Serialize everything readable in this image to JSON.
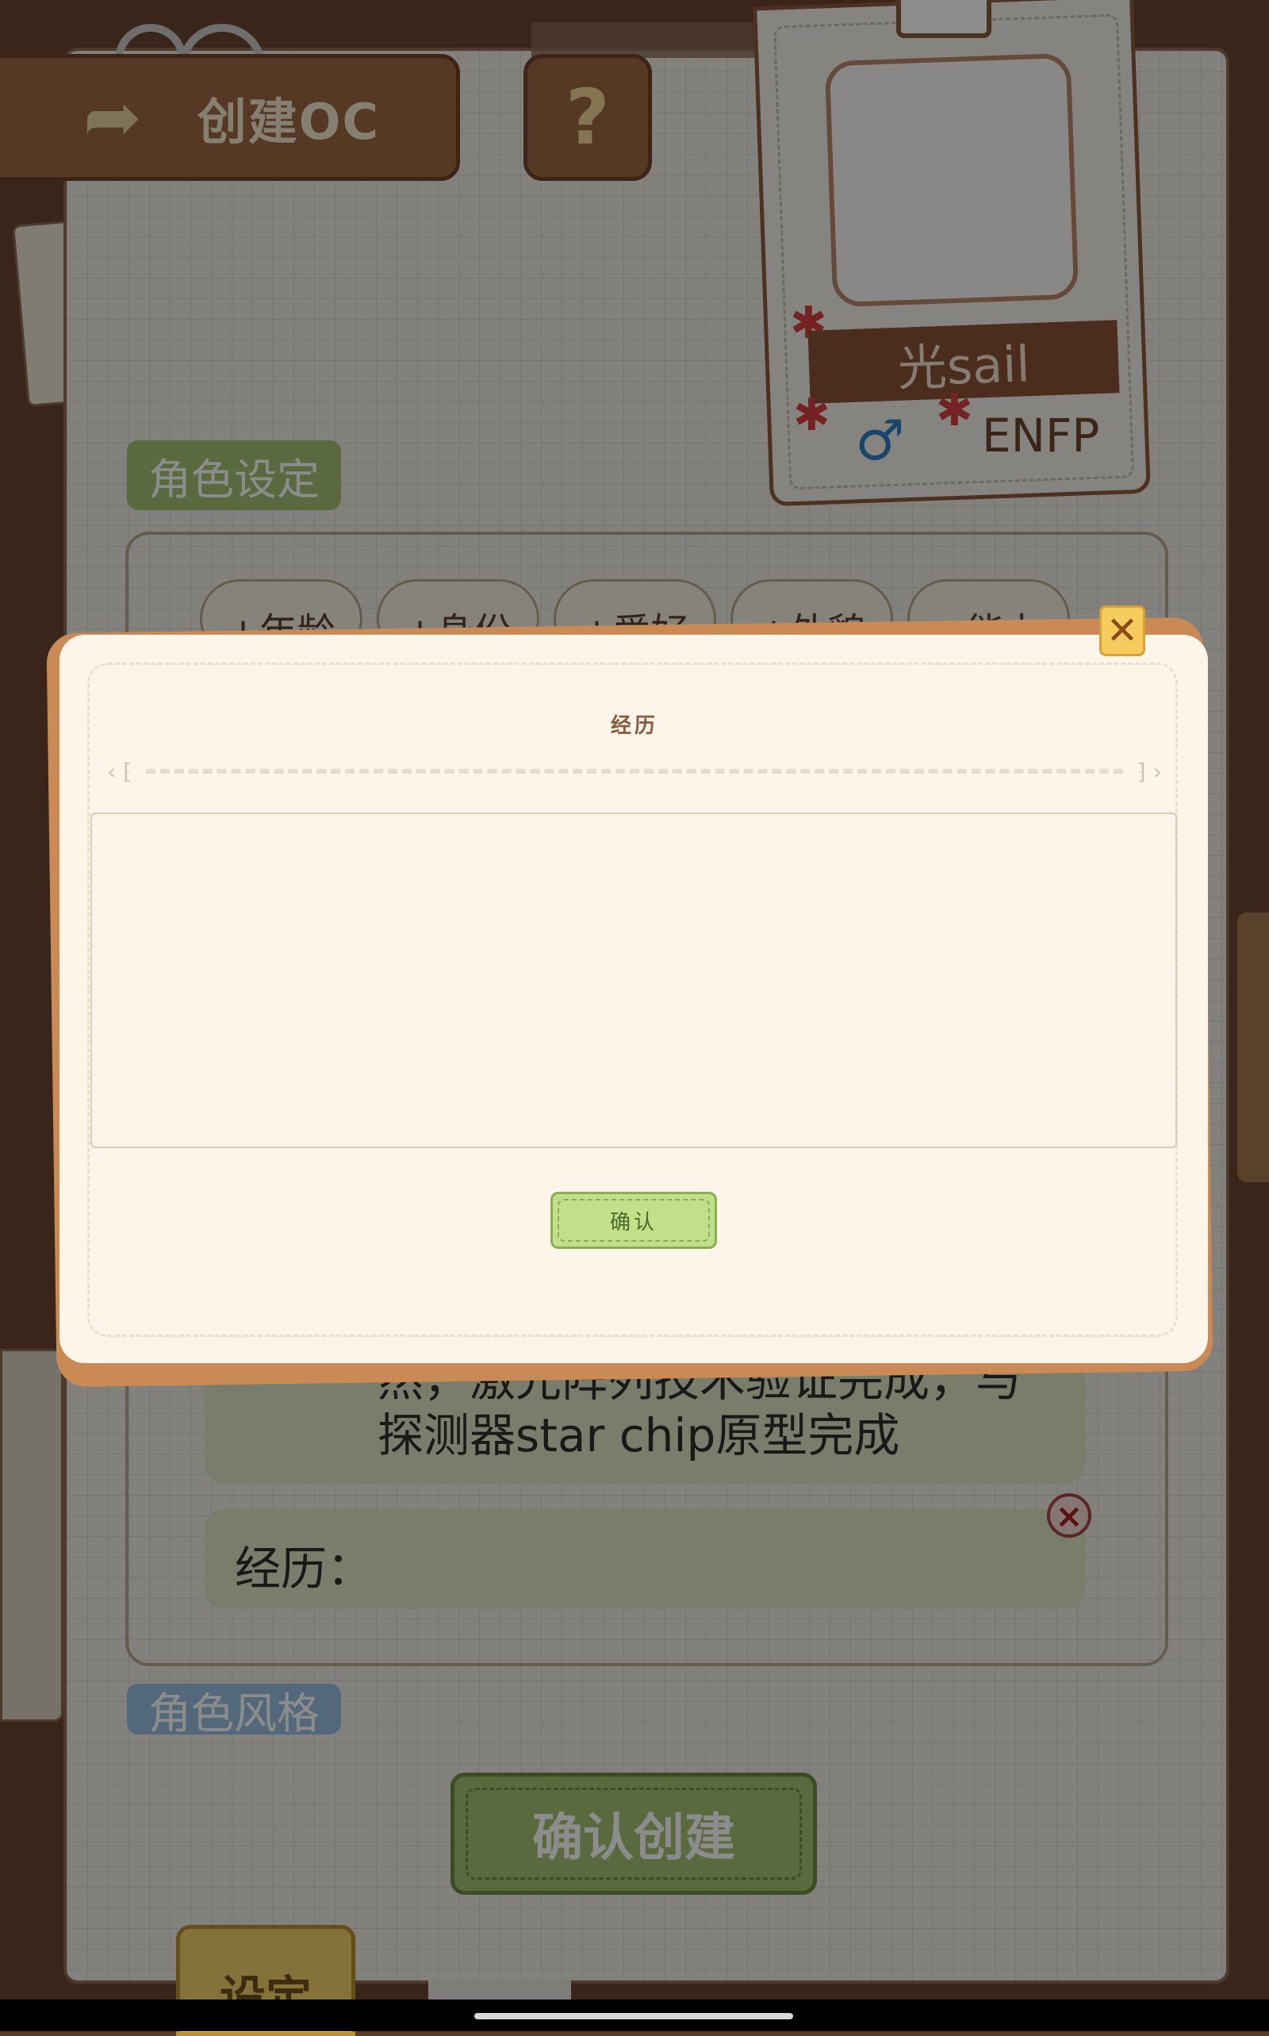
{
  "header": {
    "back_icon": "back-arrow-icon",
    "title": "创建OC",
    "help_label": "?"
  },
  "idcard": {
    "name": "光sail",
    "gender_symbol": "♂",
    "mbti": "ENFP"
  },
  "role_settings": {
    "label": "角色设定",
    "tags": [
      "+年龄",
      "+身份",
      "+爱好",
      "+外貌",
      "+能力"
    ],
    "entry_text_line1": "然，激光阵列技术验证完成，与",
    "entry_text_line2": "探测器star chip原型完成",
    "experience_label": "经历："
  },
  "role_style": {
    "label": "角色风格"
  },
  "create_button": "确认创建",
  "settings_tab": "设定",
  "modal": {
    "title": "经历",
    "textarea_value": "",
    "confirm_label": "确认",
    "close_symbol": "✕"
  },
  "colors": {
    "accent_green": "#a4c271",
    "brown": "#9b6844",
    "modal_bg": "#fdf5ea"
  }
}
